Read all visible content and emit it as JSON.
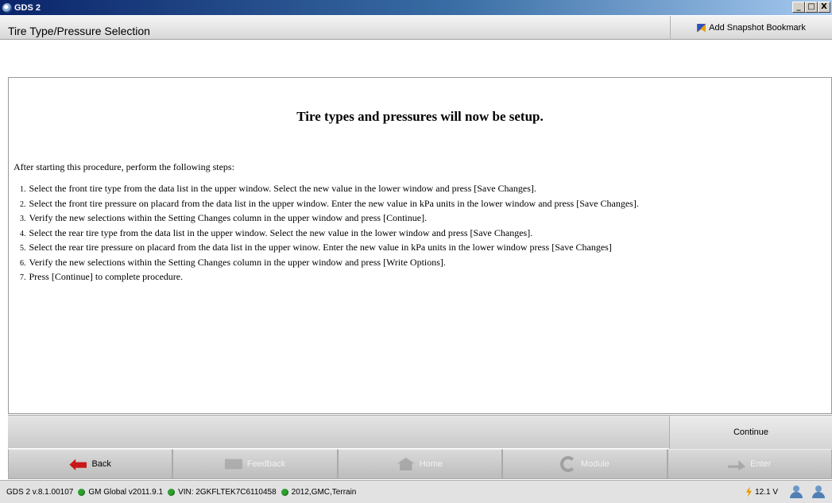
{
  "window": {
    "title": "GDS 2",
    "controls": [
      "_",
      "□",
      "X"
    ]
  },
  "header": {
    "title": "Tire Type/Pressure Selection",
    "bookmark_label": "Add Snapshot Bookmark"
  },
  "content": {
    "heading": "Tire types and pressures will now be setup.",
    "intro": "After starting this procedure, perform the following steps:",
    "steps": [
      {
        "num": "1.",
        "text": "Select the front tire type from the data list in the upper window. Select the new value in the lower window and press [Save Changes]."
      },
      {
        "num": "2.",
        "text": "Select the front tire pressure on placard from the data list in the upper window. Enter the new value in kPa units in the lower window and press [Save Changes]."
      },
      {
        "num": "3.",
        "text": "Verify the new selections within the Setting Changes column in the upper window and press [Continue]."
      },
      {
        "num": "4.",
        "text": "Select the rear tire type from the data list in the upper window. Select the new value in the lower window and press [Save Changes]."
      },
      {
        "num": "5.",
        "text": "Select the rear tire pressure on placard from the data list in the upper winow. Enter the new value in kPa units in the lower window press [Save Changes]"
      },
      {
        "num": "6.",
        "text": "Verify the new selections within the Setting Changes column in the upper window and press [Write Options]."
      },
      {
        "num": "7.",
        "text": "Press [Continue] to complete procedure."
      }
    ]
  },
  "actions": {
    "continue_label": "Continue"
  },
  "nav": {
    "back": "Back",
    "feedback": "Feedback",
    "home": "Home",
    "module": "Module",
    "enter": "Enter"
  },
  "status": {
    "version": "GDS 2 v.8.1.00107",
    "global": "GM Global v2011.9.1",
    "vin": "VIN: 2GKFLTEK7C6110458",
    "vehicle": "2012,GMC,Terrain",
    "voltage": "12.1 V",
    "indicator_color": "#2ca02c"
  }
}
